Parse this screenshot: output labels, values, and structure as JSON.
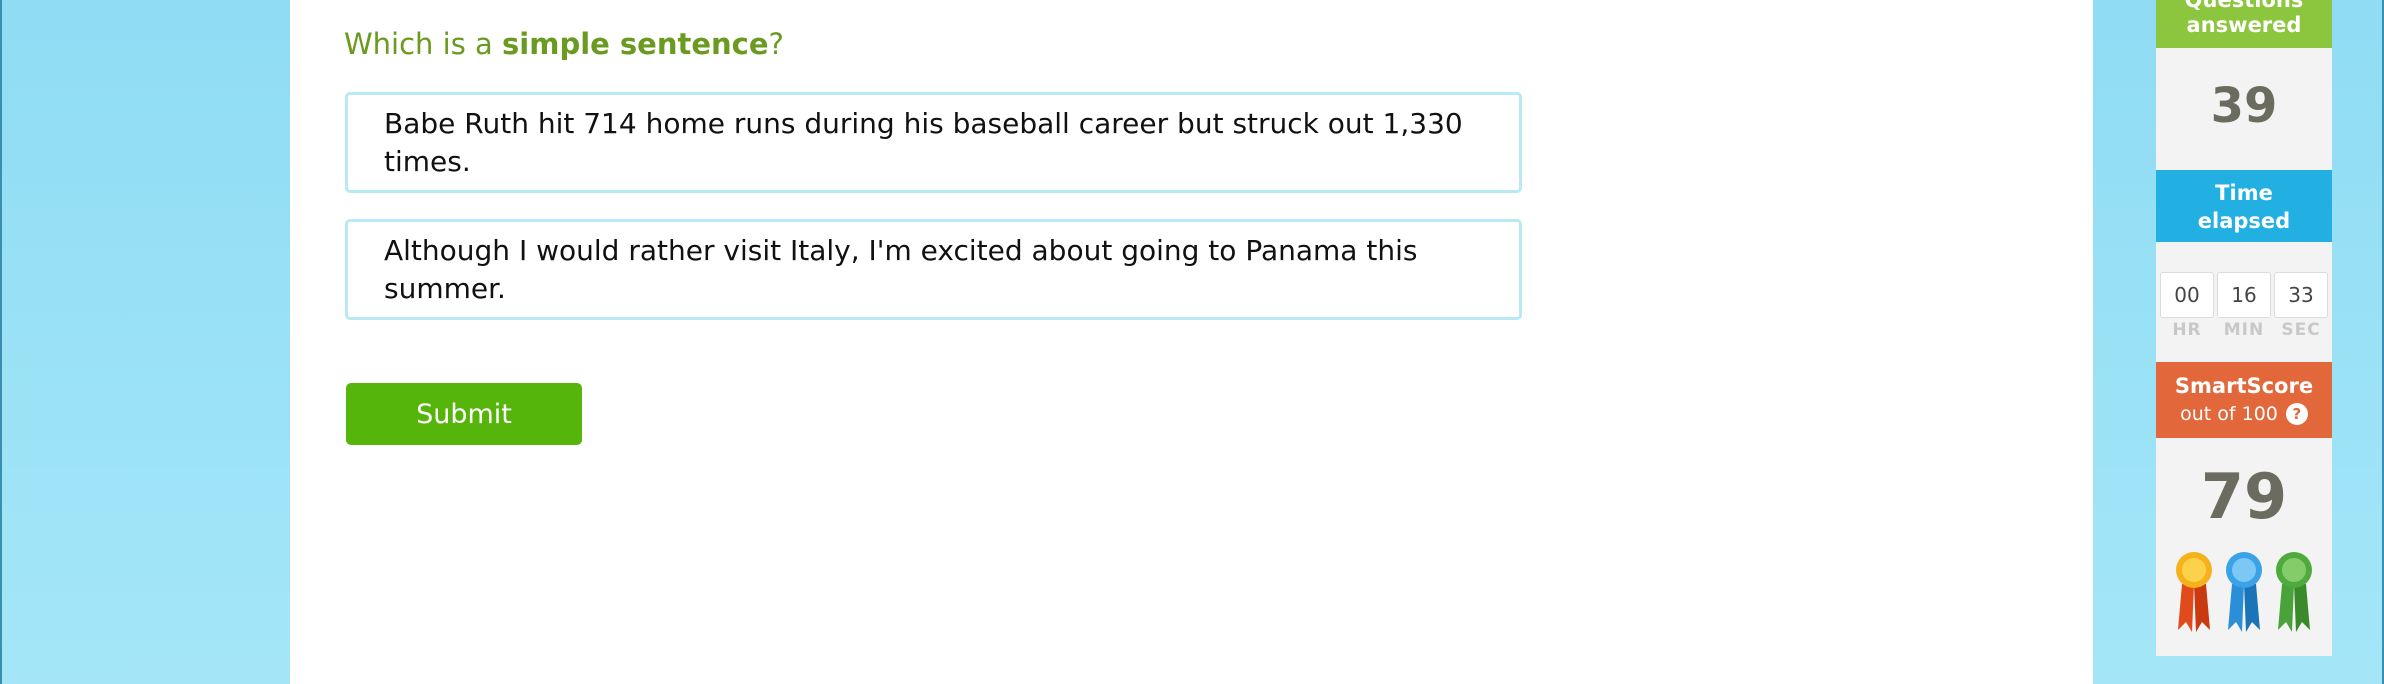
{
  "question": {
    "prefix": "Which is a ",
    "emphasis": "simple sentence",
    "suffix": "?"
  },
  "choices": [
    "Babe Ruth hit 714 home runs during his baseball career but struck out 1,330 times.",
    "Although I would rather visit Italy, I'm excited about going to Panama this summer."
  ],
  "submit_label": "Submit",
  "sidebar": {
    "questions_answered": {
      "label_line1": "Questions",
      "label_line2": "answered",
      "value": "39",
      "color": "#8cc63e"
    },
    "time_elapsed": {
      "label_line1": "Time",
      "label_line2": "elapsed",
      "hours": "00",
      "minutes": "16",
      "seconds": "33",
      "hr_label": "HR",
      "min_label": "MIN",
      "sec_label": "SEC",
      "color": "#22b0e2"
    },
    "smartscore": {
      "label_line1": "SmartScore",
      "label_line2": "out of 100",
      "help_icon": "?",
      "value": "79",
      "color": "#e2673a"
    },
    "ribbons": [
      "gold-ribbon-icon",
      "blue-ribbon-icon",
      "green-ribbon-icon"
    ]
  },
  "colors": {
    "accent_green": "#56b50a",
    "question_green": "#6a9a1f",
    "choice_border": "#b8eaf5"
  }
}
